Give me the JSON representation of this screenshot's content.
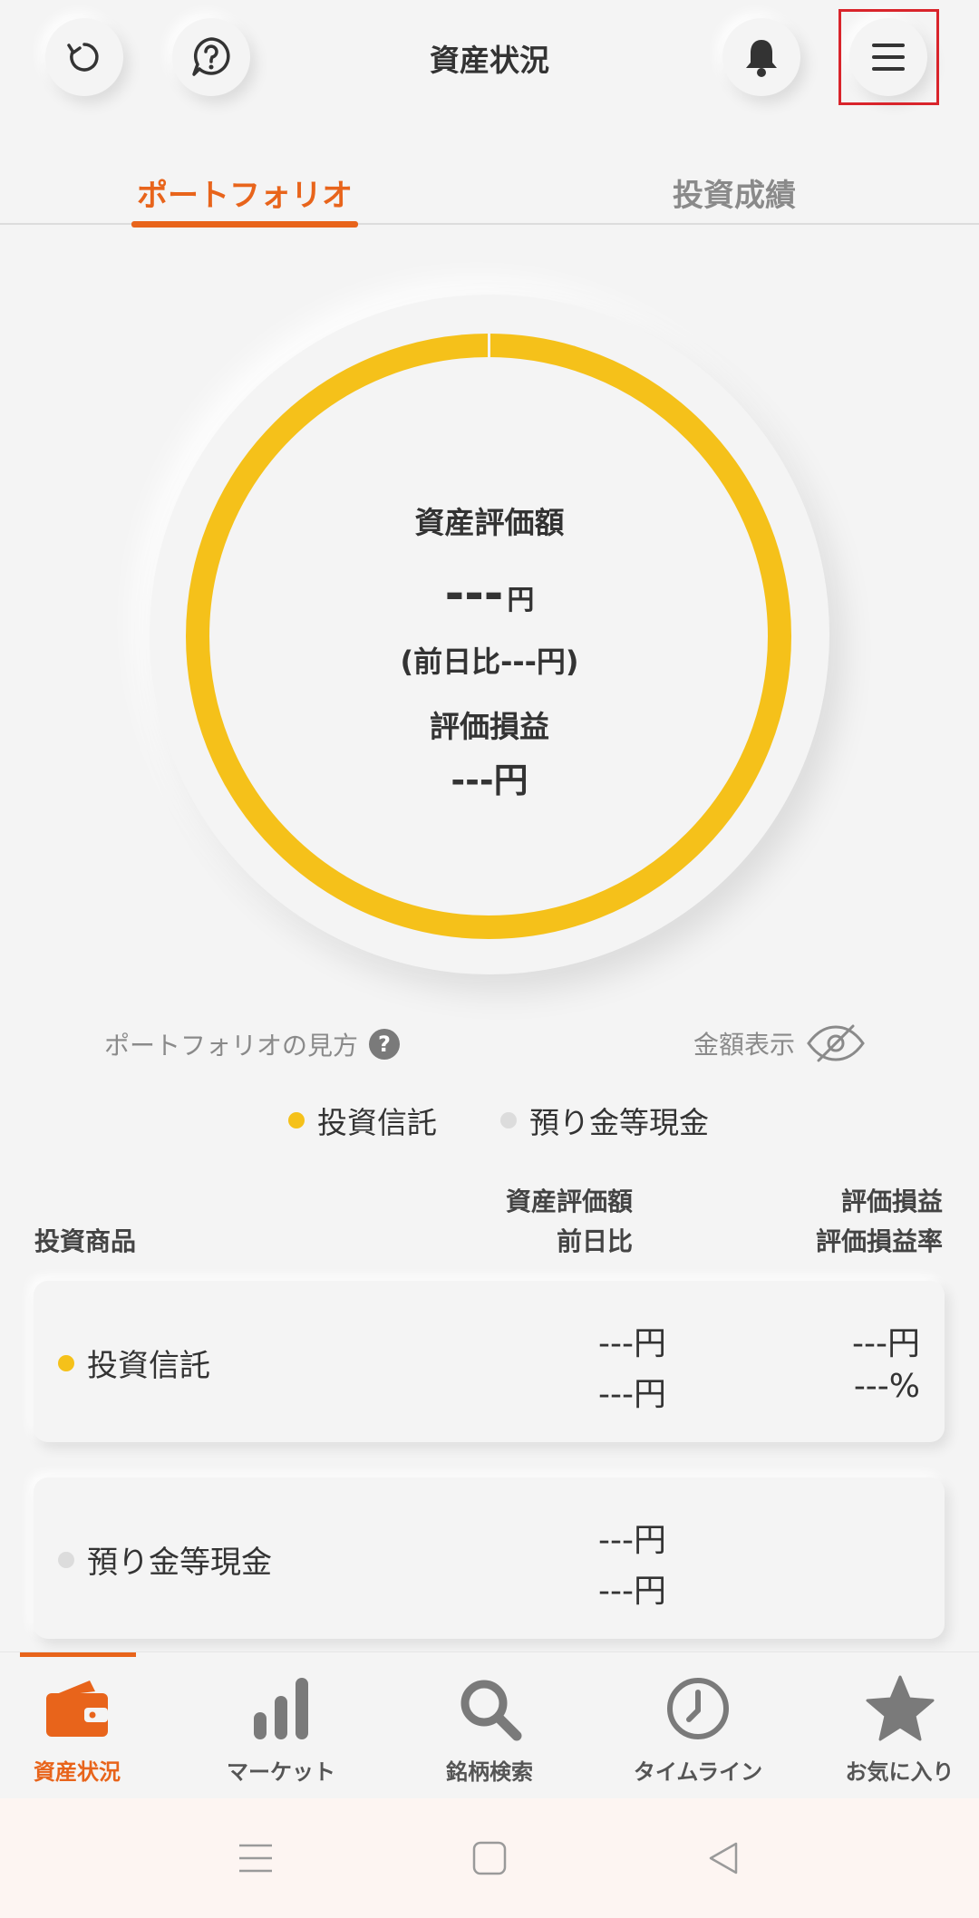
{
  "header": {
    "title": "資産状況"
  },
  "tabs": [
    {
      "label": "ポートフォリオ",
      "active": true
    },
    {
      "label": "投資成績",
      "active": false
    }
  ],
  "summary": {
    "label": "資産評価額",
    "amount": "---",
    "amount_unit": "円",
    "day_change": "(前日比---円)",
    "pnl_label": "評価損益",
    "pnl_value": "---円"
  },
  "links": {
    "how_to_view": "ポートフォリオの見方",
    "show_amount": "金額表示"
  },
  "legend": [
    {
      "label": "投資信託",
      "color": "#f5c11a"
    },
    {
      "label": "預り金等現金",
      "color": "#dcdcdc"
    }
  ],
  "table": {
    "col_product": "投資商品",
    "col_value_1": "資産評価額",
    "col_value_2": "前日比",
    "col_pnl_1": "評価損益",
    "col_pnl_2": "評価損益率",
    "rows": [
      {
        "name": "投資信託",
        "value": "---円",
        "change": "---円",
        "pnl": "---円",
        "pnl_rate": "---%"
      },
      {
        "name": "預り金等現金",
        "value": "---円",
        "change": "---円"
      }
    ]
  },
  "bottom_nav": [
    {
      "label": "資産状況",
      "icon": "wallet-icon",
      "active": true
    },
    {
      "label": "マーケット",
      "icon": "bar-chart-icon",
      "active": false
    },
    {
      "label": "銘柄検索",
      "icon": "search-icon",
      "active": false
    },
    {
      "label": "タイムライン",
      "icon": "clock-icon",
      "active": false
    },
    {
      "label": "お気に入り",
      "icon": "star-icon",
      "active": false
    }
  ],
  "colors": {
    "accent": "#e8641b",
    "fund": "#f5c11a",
    "cash": "#dcdcdc",
    "highlight_box": "#d9242b"
  }
}
